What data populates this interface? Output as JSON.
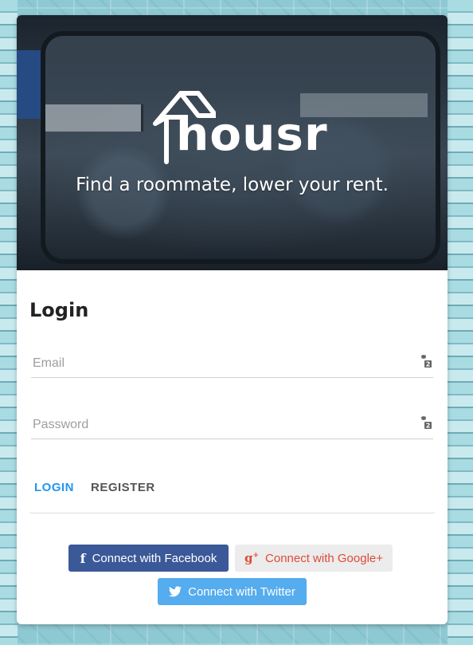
{
  "brand": {
    "name": "housr",
    "tagline": "Find a roommate, lower your rent."
  },
  "login": {
    "title": "Login",
    "email_placeholder": "Email",
    "password_placeholder": "Password"
  },
  "tabs": {
    "login_label": "LOGIN",
    "register_label": "REGISTER"
  },
  "social": {
    "facebook_label": "Connect with Facebook",
    "google_label": "Connect with Google+",
    "twitter_label": "Connect with Twitter"
  },
  "colors": {
    "primary": "#2196f3",
    "facebook": "#3b5998",
    "google": "#dd4b39",
    "twitter": "#55acee"
  },
  "icons": {
    "field_icon": "password-manager-key-icon",
    "facebook_icon": "facebook-f-icon",
    "google_icon": "google-plus-icon",
    "twitter_icon": "twitter-bird-icon"
  }
}
